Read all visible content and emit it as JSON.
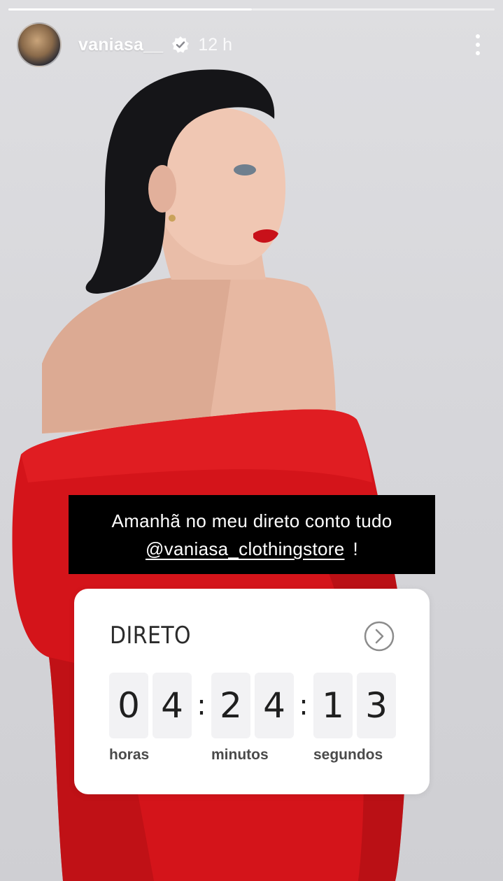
{
  "story": {
    "progress_segments": [
      {
        "state": "viewed",
        "fill_fraction": 1.0
      },
      {
        "state": "current",
        "fill_fraction": 0.0
      }
    ]
  },
  "header": {
    "username": "vaniasa__",
    "verified": true,
    "verified_icon": "verified-badge-icon",
    "time_ago": "12 h",
    "more_icon": "more-vertical-icon"
  },
  "caption": {
    "line1": "Amanhã no meu direto conto tudo",
    "mention": "@vaniasa_clothingstore",
    "suffix": "!"
  },
  "countdown": {
    "title": "DIRETO",
    "arrow_icon": "chevron-right-circle-icon",
    "hours": [
      "0",
      "4"
    ],
    "minutes": [
      "2",
      "4"
    ],
    "seconds": [
      "1",
      "3"
    ],
    "separator": ":",
    "labels": {
      "hours": "horas",
      "minutes": "minutos",
      "seconds": "segundos"
    }
  },
  "colors": {
    "caption_bg": "#000000",
    "caption_text": "#ffffff",
    "sticker_bg": "#ffffff",
    "digit_bg": "#f2f2f4",
    "dress_red": "#d4141a",
    "wall": "#d9d9dc"
  }
}
